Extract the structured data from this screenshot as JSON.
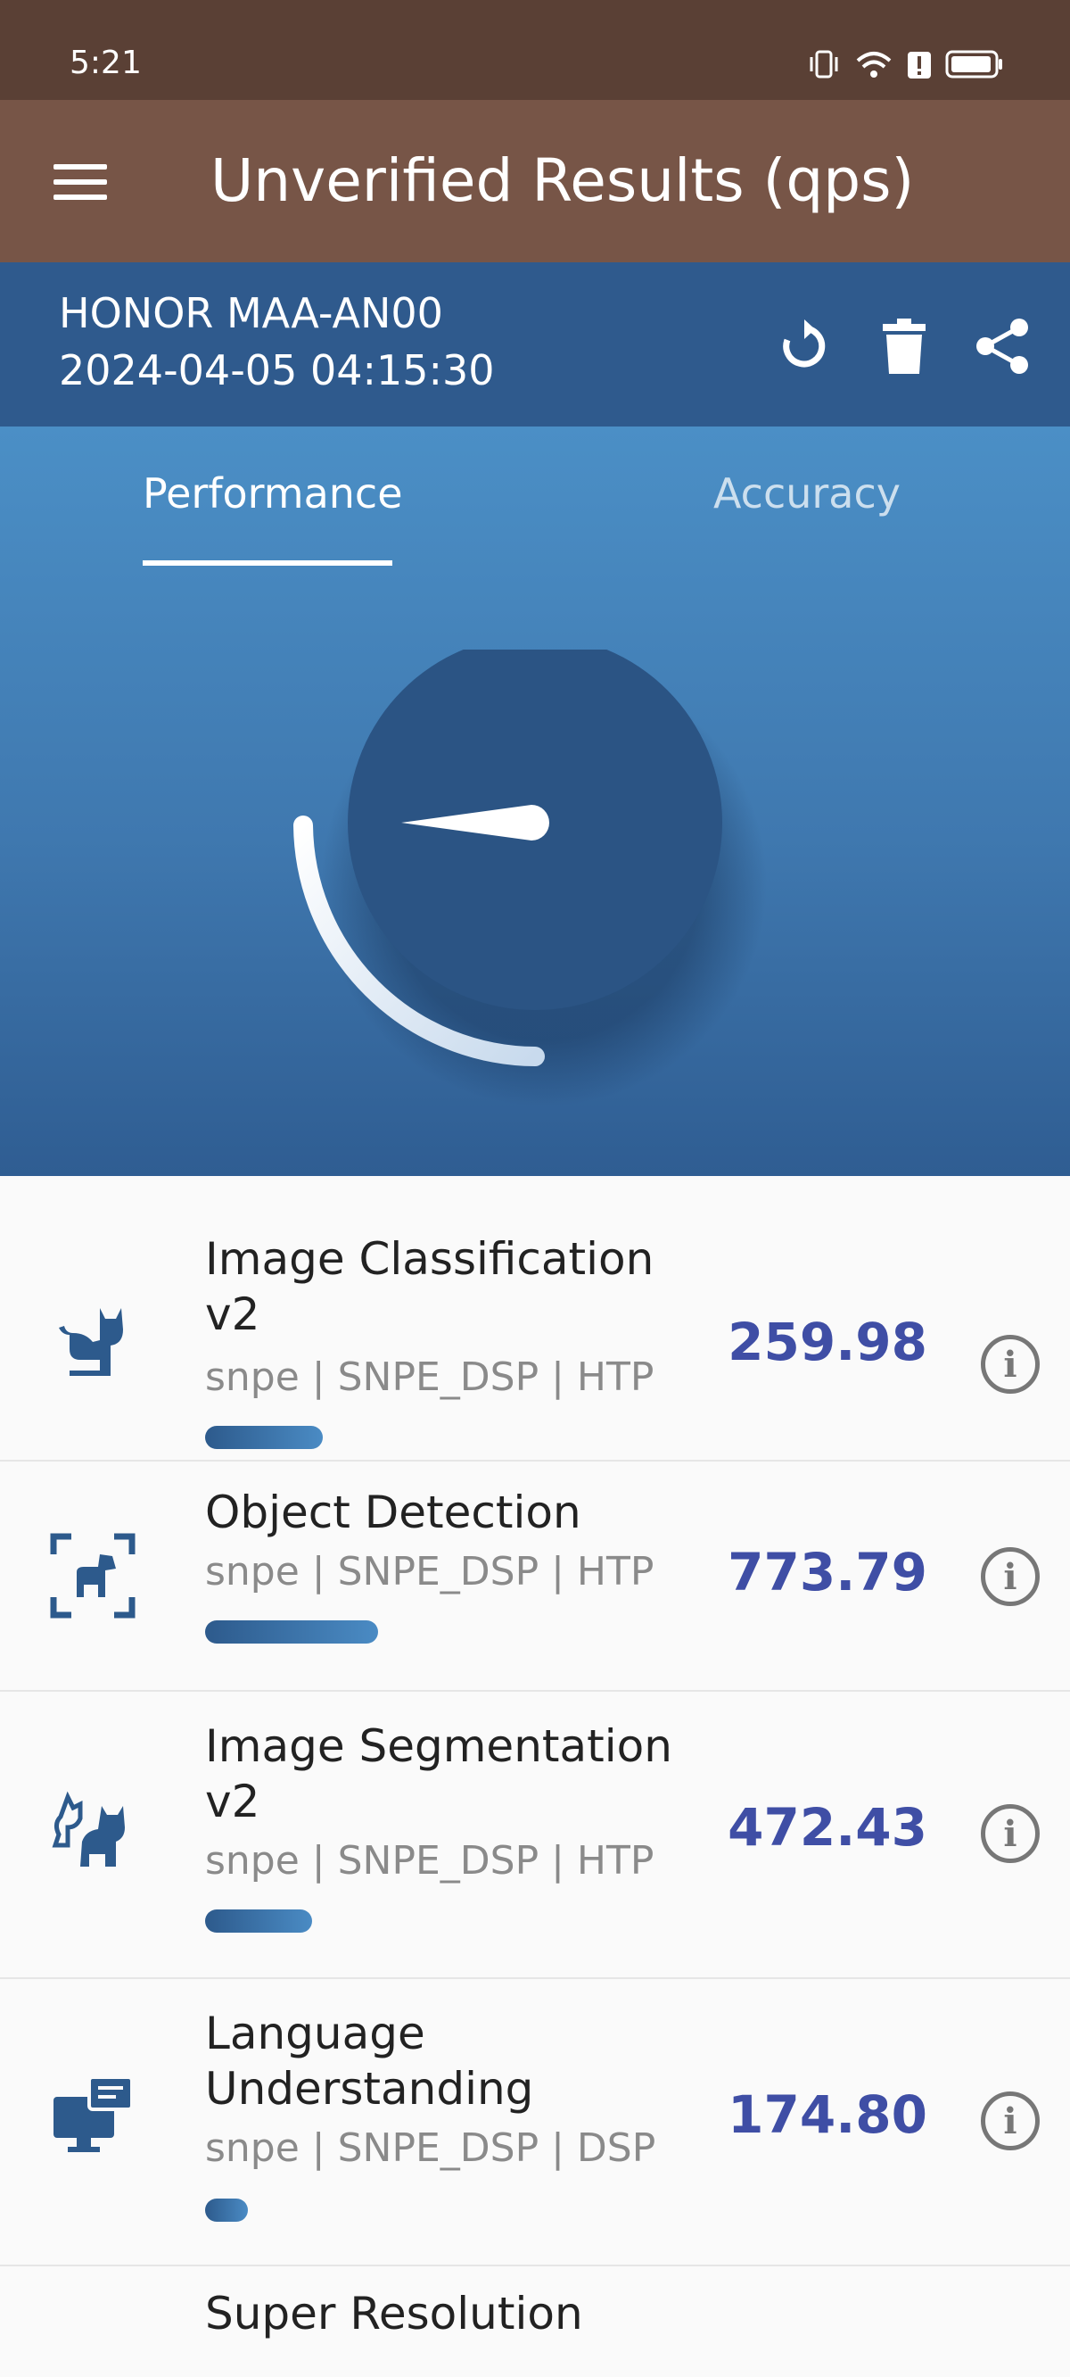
{
  "status": {
    "time": "5:21"
  },
  "app_bar": {
    "title": "Unverified Results (qps)"
  },
  "device": {
    "name": "HONOR MAA-AN00",
    "date": "2024-04-05 04:15:30"
  },
  "tabs": [
    {
      "label": "Performance",
      "selected": true
    },
    {
      "label": "Accuracy",
      "selected": false
    }
  ],
  "colors": {
    "status_bar": "#5a4035",
    "app_bar": "#775547",
    "device_bar": "#2f5a8d",
    "accent_score": "#3f4ea5"
  },
  "results": [
    {
      "title": "Image Classification v2",
      "subtitle": "snpe | SNPE_DSP | HTP",
      "score": "259.98",
      "bar_fraction": 0.25,
      "icon": "cat-icon"
    },
    {
      "title": "Object Detection",
      "subtitle": "snpe | SNPE_DSP | HTP",
      "score": "773.79",
      "bar_fraction": 0.37,
      "icon": "dog-detect-icon"
    },
    {
      "title": "Image Segmentation v2",
      "subtitle": "snpe | SNPE_DSP | HTP",
      "score": "472.43",
      "bar_fraction": 0.23,
      "icon": "pets-icon"
    },
    {
      "title": "Language Understanding",
      "subtitle": "snpe | SNPE_DSP | DSP",
      "score": "174.80",
      "bar_fraction": 0.09,
      "icon": "monitor-chat-icon"
    },
    {
      "title": "Super Resolution"
    }
  ]
}
